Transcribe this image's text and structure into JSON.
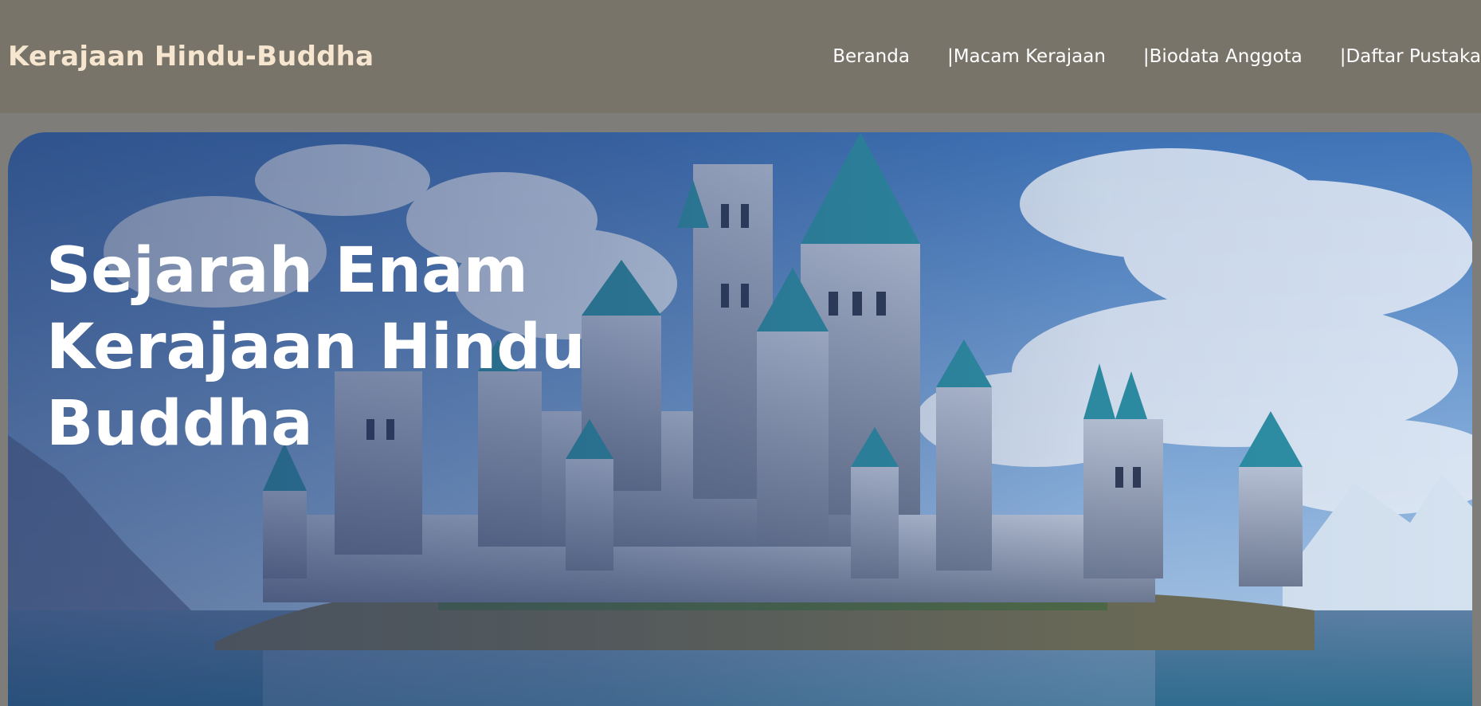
{
  "header": {
    "brand": "Kerajaan Hindu-Buddha",
    "nav": [
      {
        "label": "Beranda"
      },
      {
        "label": "|Macam Kerajaan"
      },
      {
        "label": "|Biodata Anggota"
      },
      {
        "label": "|Daftar Pustaka"
      }
    ]
  },
  "hero": {
    "title": "Sejarah Enam Kerajaan Hindu Buddha",
    "image": "castle-on-island-image"
  },
  "colors": {
    "navbar_bg": "#78746a",
    "brand_text": "#f6e6cf",
    "page_bg": "#7f7d79"
  }
}
